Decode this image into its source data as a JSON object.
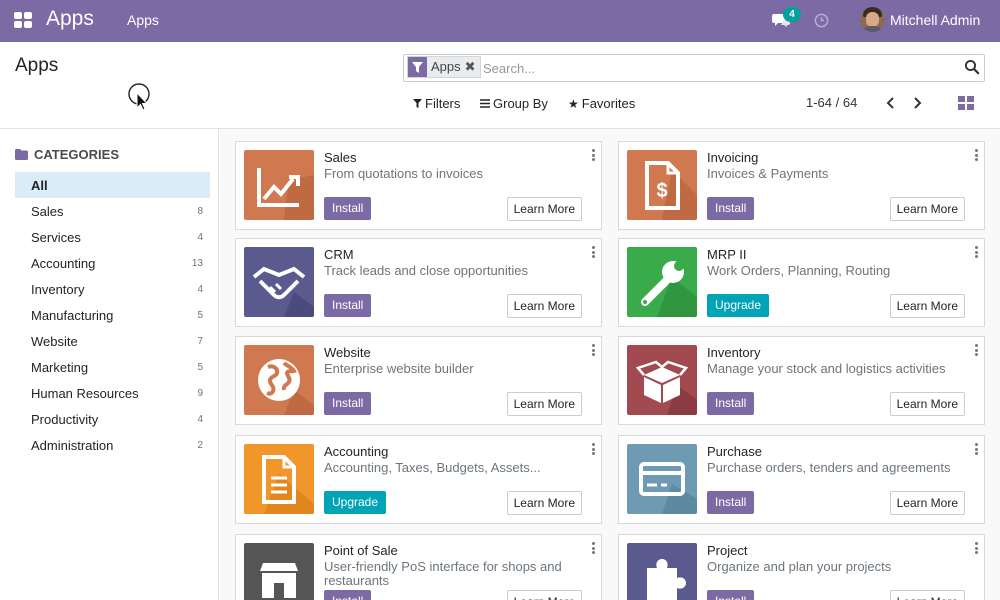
{
  "navbar": {
    "brand": "Apps",
    "menu_item": "Apps",
    "chat_count": "4",
    "user_name": "Mitchell Admin",
    "color": "#7c6aa5"
  },
  "control_panel": {
    "title": "Apps",
    "facet_label": "Apps",
    "facet_close": "✖",
    "search_placeholder": "Search...",
    "filters_label": "Filters",
    "group_by_label": "Group By",
    "favorites_label": "Favorites",
    "pager": "1-64 / 64"
  },
  "sidebar": {
    "header": "CATEGORIES",
    "items": [
      {
        "label": "All",
        "count": ""
      },
      {
        "label": "Sales",
        "count": "8"
      },
      {
        "label": "Services",
        "count": "4"
      },
      {
        "label": "Accounting",
        "count": "13"
      },
      {
        "label": "Inventory",
        "count": "4"
      },
      {
        "label": "Manufacturing",
        "count": "5"
      },
      {
        "label": "Website",
        "count": "7"
      },
      {
        "label": "Marketing",
        "count": "5"
      },
      {
        "label": "Human Resources",
        "count": "9"
      },
      {
        "label": "Productivity",
        "count": "4"
      },
      {
        "label": "Administration",
        "count": "2"
      }
    ]
  },
  "apps": [
    {
      "name": "Sales",
      "summary": "From quotations to invoices",
      "action": "Install",
      "learn": "Learn More",
      "icon": "sales-chart-icon",
      "color": "#d0784f"
    },
    {
      "name": "Invoicing",
      "summary": "Invoices & Payments",
      "action": "Install",
      "learn": "Learn More",
      "icon": "invoice-dollar-icon",
      "color": "#d0784f"
    },
    {
      "name": "CRM",
      "summary": "Track leads and close opportunities",
      "action": "Install",
      "learn": "Learn More",
      "icon": "handshake-icon",
      "color": "#5b5a8e"
    },
    {
      "name": "MRP II",
      "summary": "Work Orders, Planning, Routing",
      "action": "Upgrade",
      "learn": "Learn More",
      "icon": "wrench-icon",
      "color": "#3aab4a"
    },
    {
      "name": "Website",
      "summary": "Enterprise website builder",
      "action": "Install",
      "learn": "Learn More",
      "icon": "globe-icon",
      "color": "#d0784f"
    },
    {
      "name": "Inventory",
      "summary": "Manage your stock and logistics activities",
      "action": "Install",
      "learn": "Learn More",
      "icon": "box-icon",
      "color": "#a14a50"
    },
    {
      "name": "Accounting",
      "summary": "Accounting, Taxes, Budgets, Assets...",
      "action": "Upgrade",
      "learn": "Learn More",
      "icon": "document-icon",
      "color": "#f0962a"
    },
    {
      "name": "Purchase",
      "summary": "Purchase orders, tenders and agreements",
      "action": "Install",
      "learn": "Learn More",
      "icon": "credit-card-icon",
      "color": "#6e9ab4"
    },
    {
      "name": "Point of Sale",
      "summary": "User-friendly PoS interface for shops and restaurants",
      "action": "Install",
      "learn": "Learn More",
      "icon": "shop-icon",
      "color": "#555555"
    },
    {
      "name": "Project",
      "summary": "Organize and plan your projects",
      "action": "Install",
      "learn": "Learn More",
      "icon": "puzzle-icon",
      "color": "#5b5a8e"
    }
  ]
}
